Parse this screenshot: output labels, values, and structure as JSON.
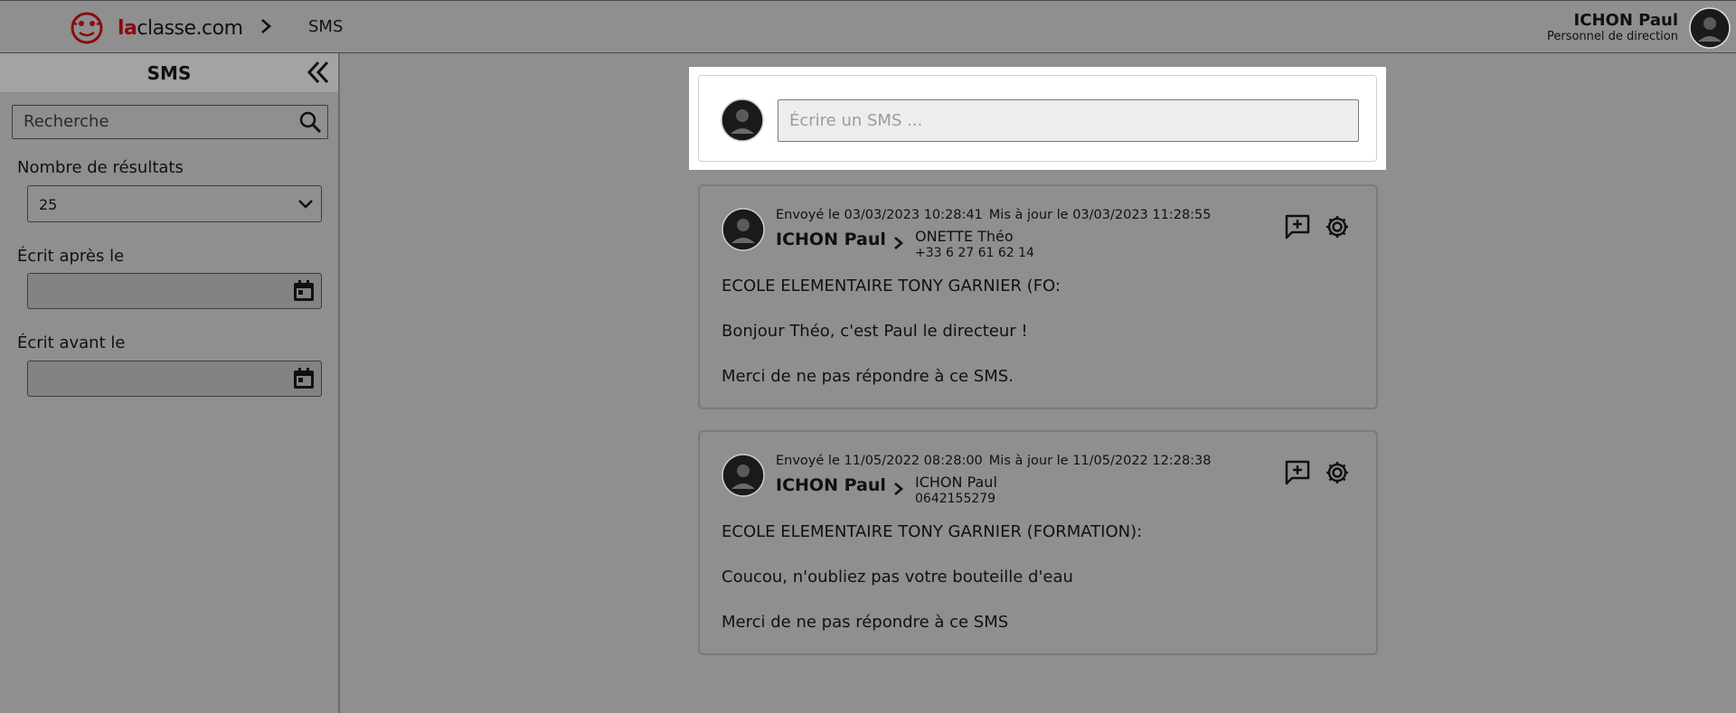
{
  "topbar": {
    "logo_prefix": "la",
    "logo_rest": "classe.com",
    "breadcrumb_current": "SMS",
    "user_name": "ICHON Paul",
    "user_role": "Personnel de direction"
  },
  "sidebar": {
    "title": "SMS",
    "search_placeholder": "Recherche",
    "results_label": "Nombre de résultats",
    "results_value": "25",
    "after_label": "Écrit après le",
    "after_value": "",
    "before_label": "Écrit avant le",
    "before_value": ""
  },
  "compose": {
    "placeholder": "Écrire un SMS ..."
  },
  "messages": [
    {
      "sent": "Envoyé le 03/03/2023 10:28:41",
      "updated": "Mis à jour le 03/03/2023 11:28:55",
      "sender": "ICHON Paul",
      "recipient": "ONETTE Théo",
      "phone": "+33 6 27 61 62 14",
      "lines": [
        "ECOLE ELEMENTAIRE TONY GARNIER (FO:",
        "Bonjour Théo, c'est Paul le directeur !",
        "Merci de ne pas répondre à ce SMS."
      ]
    },
    {
      "sent": "Envoyé le 11/05/2022 08:28:00",
      "updated": "Mis à jour le 11/05/2022 12:28:38",
      "sender": "ICHON Paul",
      "recipient": "ICHON Paul",
      "phone": "0642155279",
      "lines": [
        "ECOLE ELEMENTAIRE TONY GARNIER (FORMATION):",
        "Coucou, n'oubliez pas votre bouteille d'eau",
        "Merci de ne pas répondre à ce SMS"
      ]
    }
  ],
  "icons": {
    "logo": "laclasse-logo-icon",
    "breadcrumb": "chevron-right-icon",
    "collapse": "double-chevron-left-icon",
    "search": "search-icon",
    "select": "chevron-down-icon",
    "calendar": "calendar-icon",
    "add_comment": "add-comment-icon",
    "settings": "gear-icon"
  },
  "colors": {
    "brand": "#8b0a0f",
    "background": "#8f8f8f"
  }
}
